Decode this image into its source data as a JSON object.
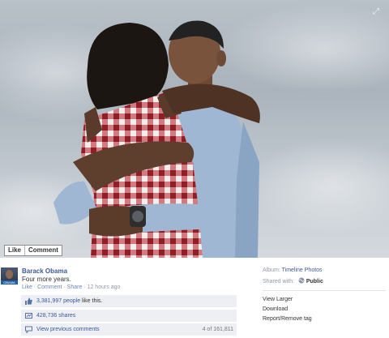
{
  "photo": {
    "actions": {
      "like_label": "Like",
      "comment_label": "Comment"
    }
  },
  "post": {
    "author": "Barack Obama",
    "caption": "Four more years.",
    "avatar_badge": "OBAMA BIDEN",
    "meta": {
      "like": "Like",
      "comment": "Comment",
      "share": "Share",
      "separator": " · ",
      "time": "12 hours ago"
    }
  },
  "ufi": {
    "likes_count": "3,381,997 people",
    "likes_suffix": " like this.",
    "shares": "428,736 shares",
    "view_previous": "View previous comments",
    "comment_count": "4 of 161,811"
  },
  "sidebar": {
    "album_label": "Album:",
    "album_name": "Timeline Photos",
    "shared_label": "Shared with:",
    "shared_value": "Public",
    "view_larger": "View Larger",
    "download": "Download",
    "report": "Report/Remove tag"
  },
  "colors": {
    "link": "#3b5998",
    "ufi_background": "#edeff4",
    "meta_gray": "#9197a3"
  },
  "icons": [
    "expand-icon",
    "thumbs-up-icon",
    "share-icon",
    "comment-bubble-icon",
    "globe-icon"
  ]
}
